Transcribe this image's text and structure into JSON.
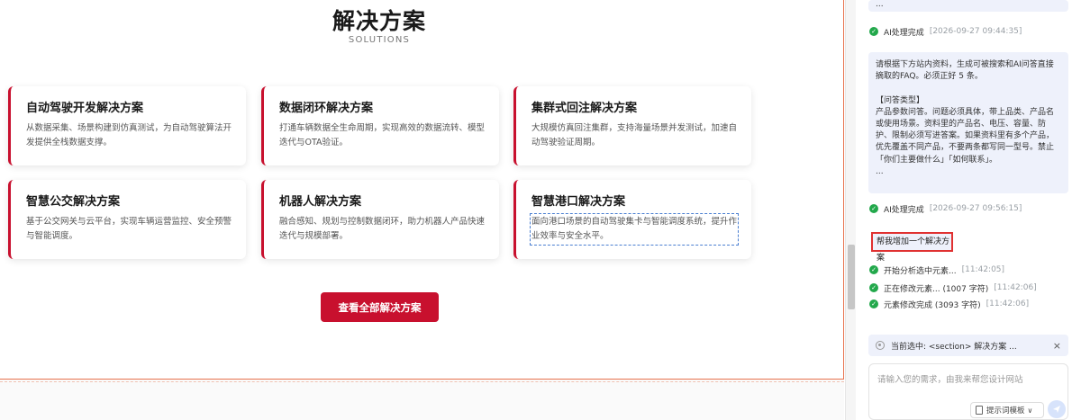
{
  "canvas": {
    "section_title": "解决方案",
    "section_subtitle": "SOLUTIONS",
    "cards": [
      {
        "title": "自动驾驶开发解决方案",
        "desc_line1": "从数据采集、场景构建到仿真测试，为自动驾驶算法开",
        "desc_line2": "发提供全栈数据支撑。"
      },
      {
        "title": "数据闭环解决方案",
        "desc_line1": "打通车辆数据全生命周期，实现高效的数据流转、模型",
        "desc_line2": "迭代与OTA验证。"
      },
      {
        "title": "集群式回注解决方案",
        "desc_line1": "大规模仿真回注集群，支持海量场景并发测试，加速自",
        "desc_line2": "动驾驶验证周期。"
      },
      {
        "title": "智慧公交解决方案",
        "desc_line1": "基于公交网关与云平台，实现车辆运营监控、安全预警",
        "desc_line2": "与智能调度。"
      },
      {
        "title": "机器人解决方案",
        "desc_line1": "融合感知、规划与控制数据闭环，助力机器人产品快速",
        "desc_line2": "迭代与规模部署。"
      },
      {
        "title": "智慧港口解决方案",
        "desc_line1": "面向港口场景的自动驾驶集卡与智能调度系统，提升作",
        "desc_line2": "业效率与安全水平。"
      }
    ],
    "view_all_label": "查看全部解决方案"
  },
  "panel": {
    "top_bubble_text": "...",
    "status1": {
      "text": "AI处理完成",
      "time": "[2026-09-27 09:44:35]"
    },
    "prompt_bubble": "请根据下方站内资料，生成可被搜索和AI问答直接摘取的FAQ。必须正好 5 条。\n\n【问答类型】\n产品参数问答。问题必须具体，带上品类、产品名或使用场景。资料里的产品名、电压、容量、防护、限制必须写进答案。如果资料里有多个产品，优先覆盖不同产品，不要两条都写同一型号。禁止「你们主要做什么」「如何联系」。\n...",
    "status2": {
      "text": "AI处理完成",
      "time": "[2026-09-27 09:56:15]"
    },
    "user_request": "帮我增加一个解决方案",
    "steps": [
      {
        "text": "开始分析选中元素...",
        "time": "[11:42:05]"
      },
      {
        "text": "正在修改元素... (1007 字符)",
        "time": "[11:42:06]"
      },
      {
        "text": "元素修改完成 (3093 字符)",
        "time": "[11:42:06]"
      }
    ],
    "selected_label": "当前选中: <section> 解决方案 ...",
    "close_icon": "×",
    "input_placeholder": "请输入您的需求，由我来帮您设计网站",
    "template_label": "提示词模板",
    "chevron": "∨"
  },
  "colors": {
    "accent": "#c8102e",
    "success": "#22a84b",
    "highlight_border": "#e03131",
    "bubble_bg": "#eef1fb"
  }
}
